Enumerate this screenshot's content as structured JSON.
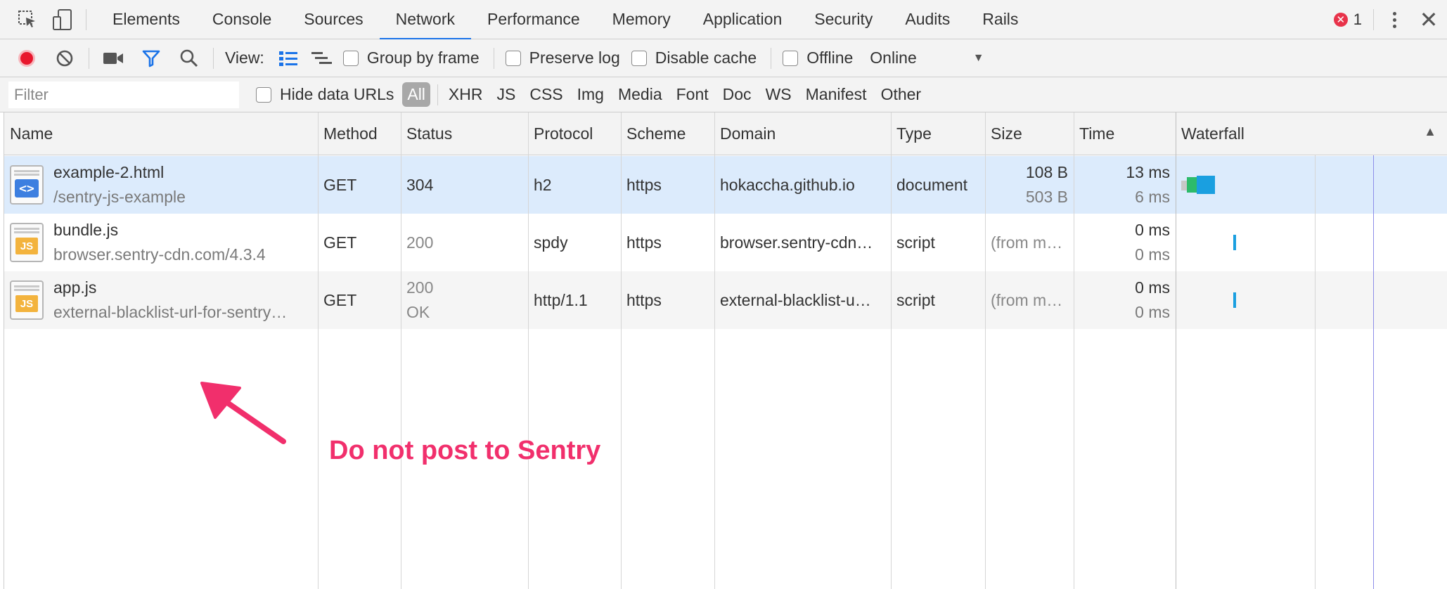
{
  "tabs": [
    {
      "label": "Elements"
    },
    {
      "label": "Console"
    },
    {
      "label": "Sources"
    },
    {
      "label": "Network",
      "active": true
    },
    {
      "label": "Performance"
    },
    {
      "label": "Memory"
    },
    {
      "label": "Application"
    },
    {
      "label": "Security"
    },
    {
      "label": "Audits"
    },
    {
      "label": "Rails"
    }
  ],
  "errors": {
    "count": "1"
  },
  "toolbar": {
    "view_label": "View:",
    "group_by_frame": "Group by frame",
    "preserve_log": "Preserve log",
    "disable_cache": "Disable cache",
    "offline": "Offline",
    "throttle": "Online"
  },
  "filter": {
    "placeholder": "Filter",
    "hide_data_urls": "Hide data URLs",
    "types": [
      "All",
      "XHR",
      "JS",
      "CSS",
      "Img",
      "Media",
      "Font",
      "Doc",
      "WS",
      "Manifest",
      "Other"
    ],
    "active_type": "All"
  },
  "columns": [
    "Name",
    "Method",
    "Status",
    "Protocol",
    "Scheme",
    "Domain",
    "Type",
    "Size",
    "Time",
    "Waterfall"
  ],
  "rows": [
    {
      "name": "example-2.html",
      "path": "/sentry-js-example",
      "icon": "document-icon",
      "method": "GET",
      "status": "304",
      "status_text": "",
      "protocol": "h2",
      "scheme": "https",
      "domain": "hokaccha.github.io",
      "type": "document",
      "size": "108 B",
      "size2": "503 B",
      "time": "13 ms",
      "time2": "6 ms"
    },
    {
      "name": "bundle.js",
      "path": "browser.sentry-cdn.com/4.3.4",
      "icon": "js-file-icon",
      "method": "GET",
      "status": "200",
      "status_text": "",
      "protocol": "spdy",
      "scheme": "https",
      "domain": "browser.sentry-cdn…",
      "type": "script",
      "size": "(from m…",
      "size2": "",
      "time": "0 ms",
      "time2": "0 ms"
    },
    {
      "name": "app.js",
      "path": "external-blacklist-url-for-sentry…",
      "icon": "js-file-icon",
      "method": "GET",
      "status": "200",
      "status_text": "OK",
      "protocol": "http/1.1",
      "scheme": "https",
      "domain": "external-blacklist-u…",
      "type": "script",
      "size": "(from m…",
      "size2": "",
      "time": "0 ms",
      "time2": "0 ms"
    }
  ],
  "annotation": {
    "text": "Do not post to Sentry",
    "color": "#f12f6c"
  },
  "colors": {
    "accent": "#1a73e8",
    "record": "#e8172d",
    "selected_row": "#dcebfc"
  }
}
